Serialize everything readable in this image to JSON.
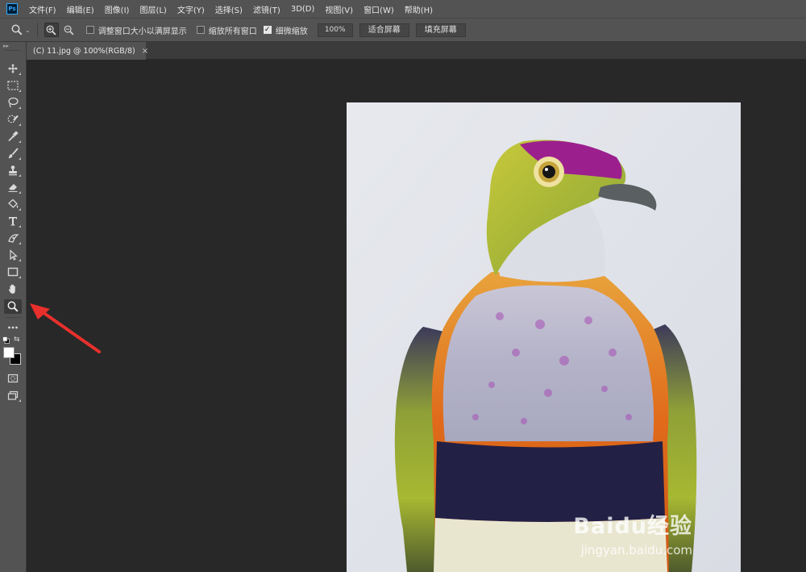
{
  "app": {
    "logo_text": "Ps"
  },
  "menubar": {
    "items": [
      "文件(F)",
      "编辑(E)",
      "图像(I)",
      "图层(L)",
      "文字(Y)",
      "选择(S)",
      "滤镜(T)",
      "3D(D)",
      "视图(V)",
      "窗口(W)",
      "帮助(H)"
    ]
  },
  "options": {
    "tool_icon": "zoom-icon",
    "zoom_in_icon": "zoom-in-icon",
    "zoom_out_icon": "zoom-out-icon",
    "resize_windows_label": "调整窗口大小以满屏显示",
    "resize_windows_checked": false,
    "zoom_all_windows_label": "缩放所有窗口",
    "zoom_all_windows_checked": false,
    "scrubby_zoom_label": "细微缩放",
    "scrubby_zoom_checked": true,
    "zoom_value": "100%",
    "fit_screen_label": "适合屏幕",
    "fill_screen_label": "填充屏幕"
  },
  "document": {
    "tab_title": "(C) 11.jpg @ 100%(RGB/8)",
    "close_glyph": "×"
  },
  "toolbox": {
    "selected_tool": "zoom-tool",
    "foreground_color": "#ffffff",
    "background_color": "#000000"
  },
  "colors": {
    "ui_panel": "#535353",
    "canvas_bg": "#282828",
    "accent_arrow": "#e8302c"
  },
  "watermark": {
    "brand": "Baidu经验",
    "url": "jingyan.baidu.com"
  }
}
